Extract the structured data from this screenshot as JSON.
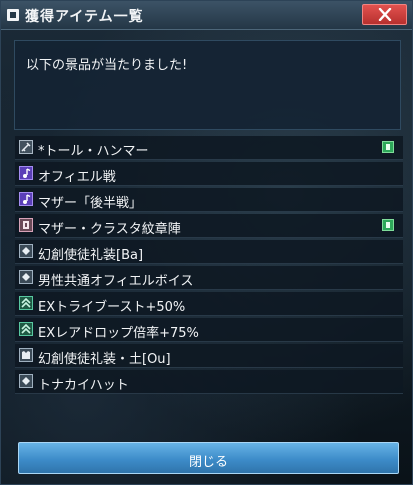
{
  "window": {
    "title": "獲得アイテム一覧",
    "close_icon": "close-x-icon"
  },
  "message": "以下の景品が当たりました!",
  "items": [
    {
      "icon": "weapon-icon",
      "label": "*トール・ハンマー",
      "locked": true
    },
    {
      "icon": "music-note-icon",
      "label": "オフィエル戦",
      "locked": false
    },
    {
      "icon": "music-note-icon",
      "label": "マザー「後半戦」",
      "locked": false
    },
    {
      "icon": "wall-decoration-icon",
      "label": "マザー・クラスタ紋章陣",
      "locked": true
    },
    {
      "icon": "ticket-icon",
      "label": "幻創使徒礼装[Ba]",
      "locked": false
    },
    {
      "icon": "ticket-icon",
      "label": "男性共通オフィエルボイス",
      "locked": false
    },
    {
      "icon": "boost-arrow-icon",
      "label": "EXトライブースト+50%",
      "locked": false
    },
    {
      "icon": "boost-arrow-icon",
      "label": "EXレアドロップ倍率+75%",
      "locked": false
    },
    {
      "icon": "costume-icon",
      "label": "幻創使徒礼装・土[Ou]",
      "locked": false
    },
    {
      "icon": "ticket-icon",
      "label": "トナカイハット",
      "locked": false
    }
  ],
  "footer": {
    "close_label": "閉じる"
  },
  "colors": {
    "title_bar": "#2f4556",
    "close_red": "#c53a37",
    "button_blue": "#3d8cc9",
    "lock_green": "#2ea85a"
  }
}
